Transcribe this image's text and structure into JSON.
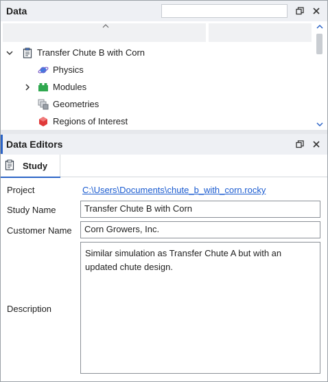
{
  "data_panel": {
    "title": "Data",
    "search": {
      "value": "",
      "placeholder": ""
    },
    "tree": [
      {
        "label": "Transfer Chute B with Corn",
        "icon": "clipboard-icon",
        "expanded": true,
        "level": 0
      },
      {
        "label": "Physics",
        "icon": "planet-icon",
        "level": 1
      },
      {
        "label": "Modules",
        "icon": "modules-icon",
        "expanded": false,
        "level": 1
      },
      {
        "label": "Geometries",
        "icon": "geometries-icon",
        "level": 1
      },
      {
        "label": "Regions of Interest",
        "icon": "regions-icon",
        "level": 1
      }
    ]
  },
  "editors_panel": {
    "title": "Data Editors",
    "tab": {
      "label": "Study",
      "icon": "clipboard-icon"
    },
    "form": {
      "project_label": "Project",
      "project_path": "C:\\Users\\Documents\\chute_b_with_corn.rocky",
      "study_name_label": "Study Name",
      "study_name_value": "Transfer Chute B with Corn",
      "customer_name_label": "Customer Name",
      "customer_name_value": "Corn Growers, Inc.",
      "description_label": "Description",
      "description_value": "Similar simulation as Transfer Chute A but with an updated chute design."
    }
  },
  "colors": {
    "accent": "#2b63c6",
    "link": "#1a5bd0",
    "titlebar": "#eef0f4"
  }
}
